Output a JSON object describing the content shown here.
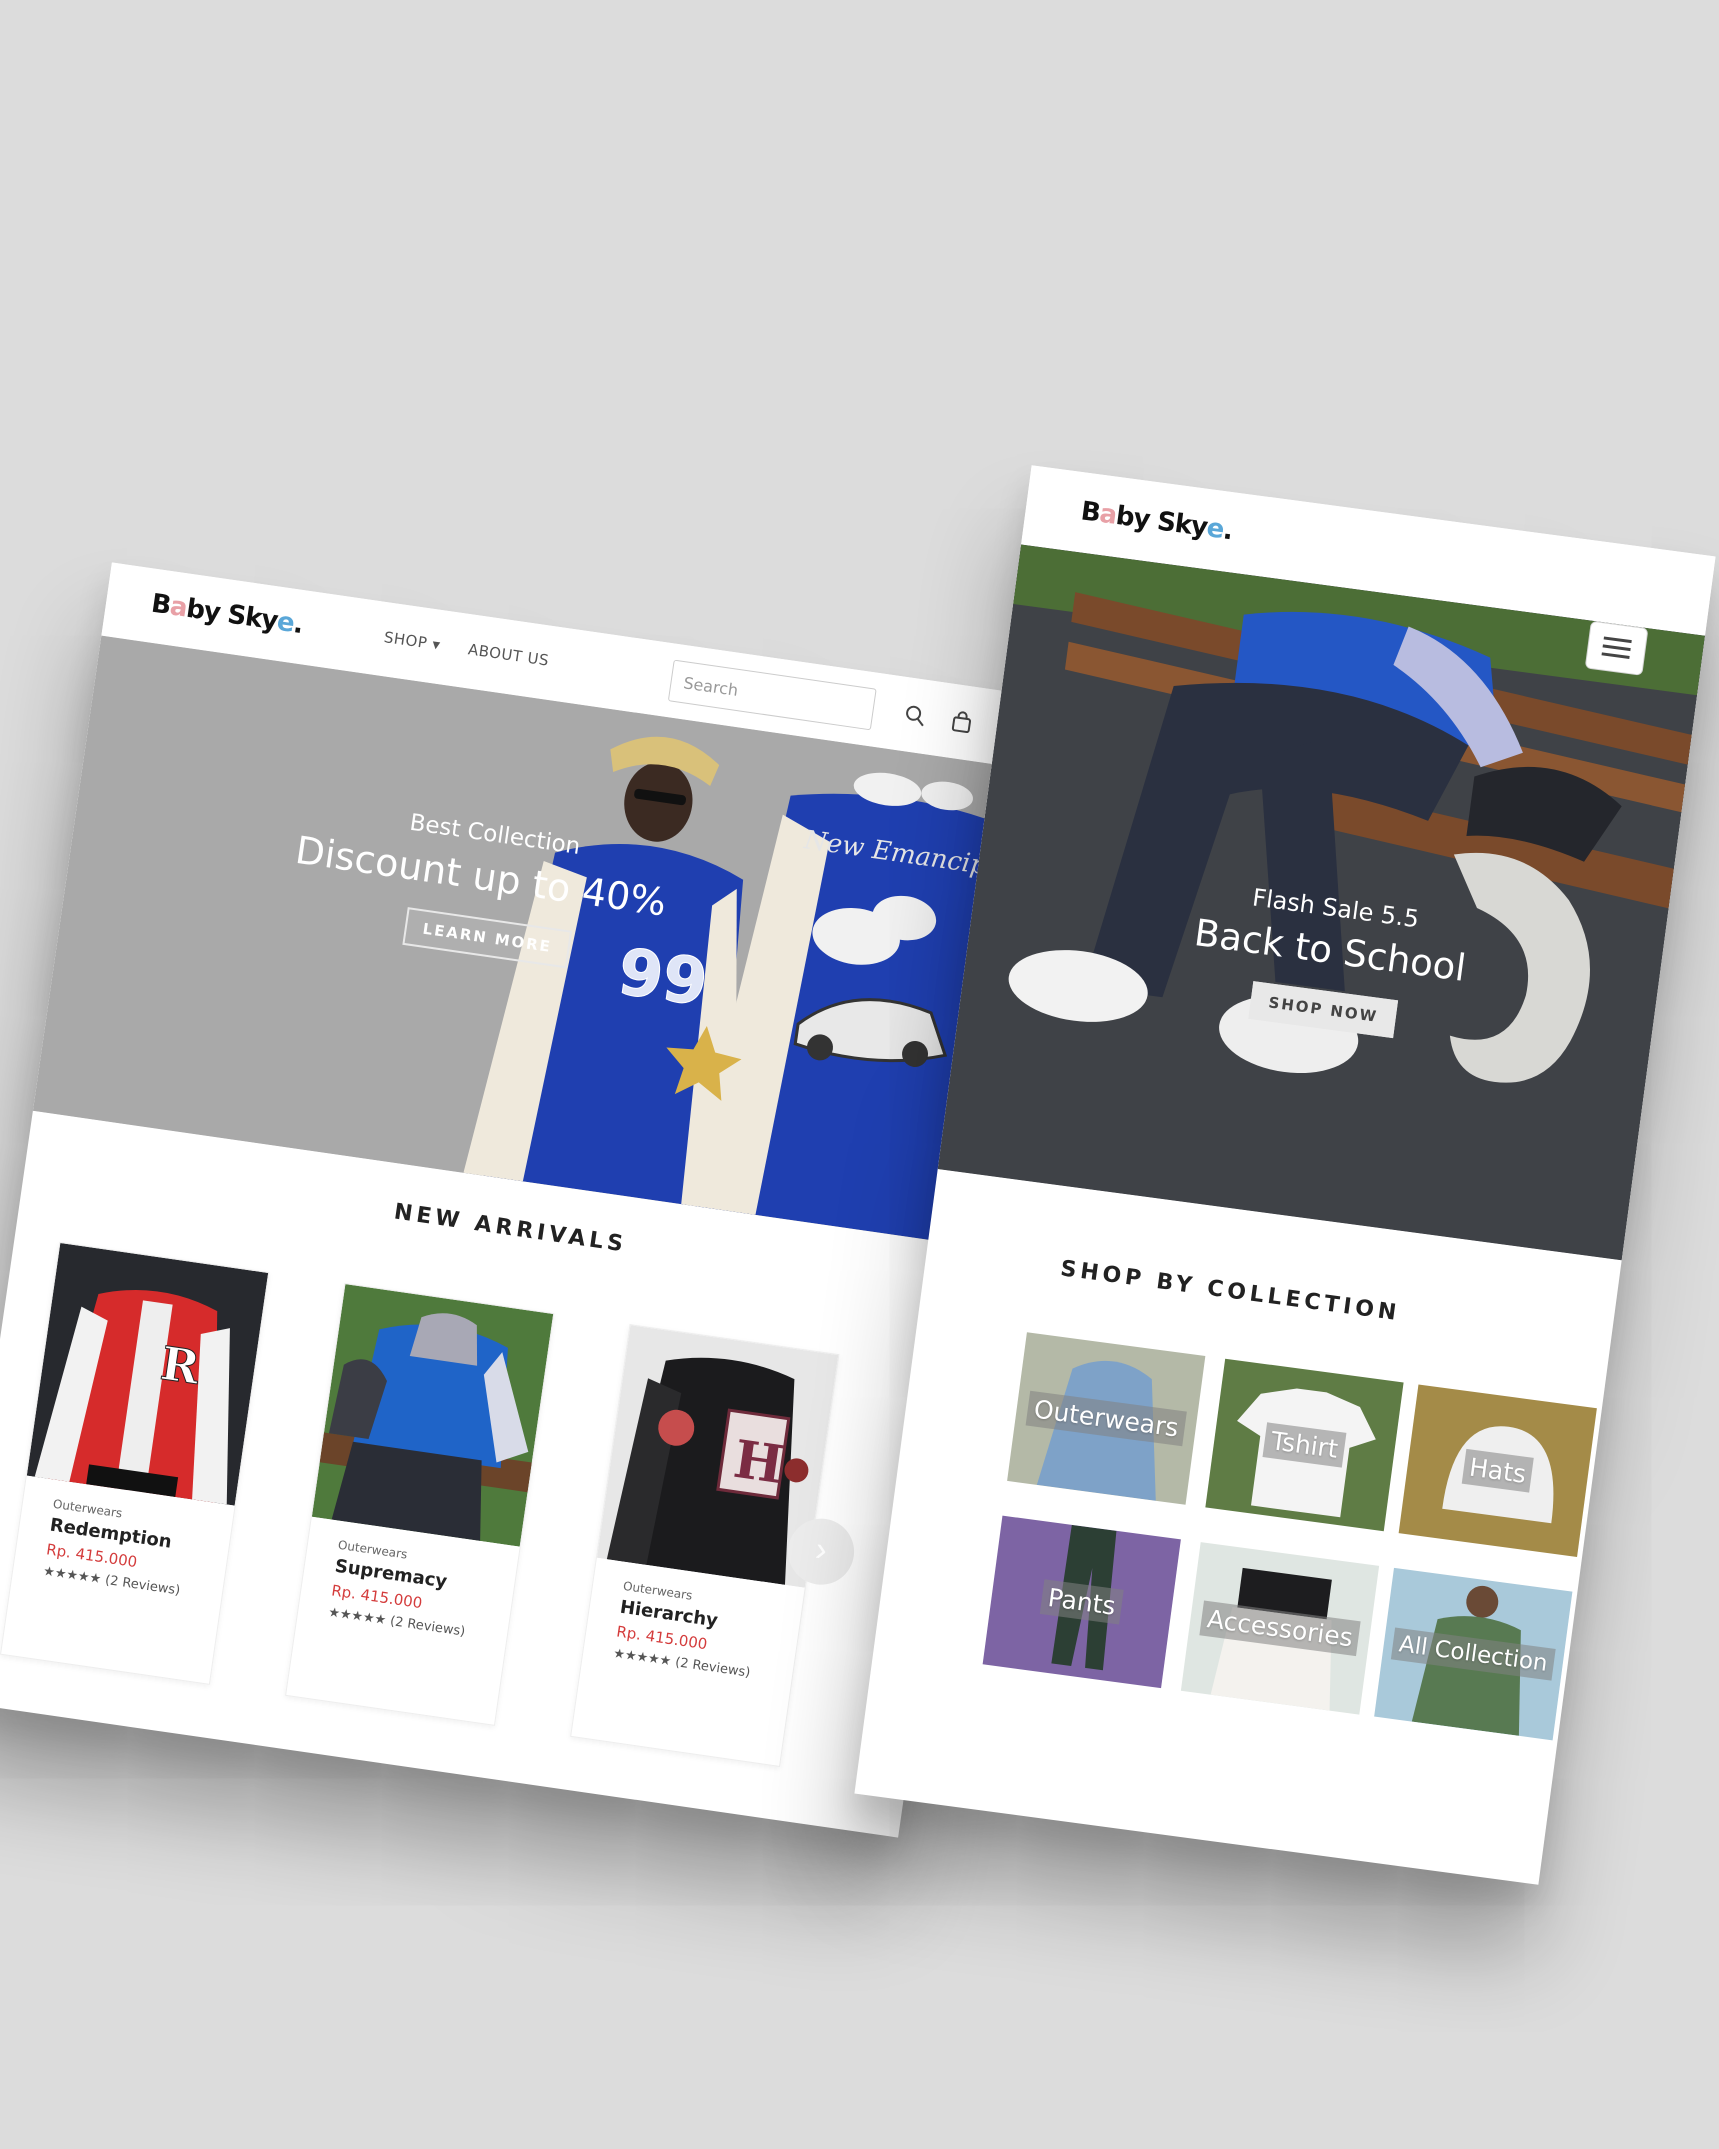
{
  "brand": {
    "logo_part1": "B",
    "logo_a": "a",
    "logo_part2": "by Sky",
    "logo_e": "e",
    "logo_dot": "."
  },
  "colors": {
    "background": "#dcdcdc",
    "price": "#d43c3c",
    "logo_a": "#e8a0a6",
    "logo_e": "#5aa7d8",
    "jacket_blue": "#1f3fb0"
  },
  "desktop": {
    "nav": {
      "shop_label": "SHOP",
      "shop_caret": "▾",
      "about_label": "ABOUT US"
    },
    "search": {
      "placeholder": "Search"
    },
    "icons": [
      "search-icon",
      "bag-icon",
      "user-icon"
    ],
    "hero": {
      "subtitle": "Best Collection",
      "title": "Discount up to 40%",
      "button": "LEARN MORE"
    },
    "new_arrivals": {
      "title": "NEW ARRIVALS",
      "products": [
        {
          "category": "Outerwears",
          "name": "Redemption",
          "price": "Rp. 415.000",
          "stars": "★★★★★",
          "reviews": "(2 Reviews)"
        },
        {
          "category": "Outerwears",
          "name": "Supremacy",
          "price": "Rp. 415.000",
          "stars": "★★★★★",
          "reviews": "(2 Reviews)"
        },
        {
          "category": "Outerwears",
          "name": "Hierarchy",
          "price": "Rp. 415.000",
          "stars": "★★★★★",
          "reviews": "(2 Reviews)"
        }
      ],
      "next_icon": "›"
    }
  },
  "mobile": {
    "hero": {
      "subtitle": "Flash Sale 5.5",
      "title": "Back to School",
      "button": "SHOP NOW"
    },
    "collection": {
      "title": "SHOP BY COLLECTION",
      "tiles": [
        {
          "label": "Outerwears",
          "color": "#b4b9a7"
        },
        {
          "label": "Tshirt",
          "color": "#5f7c45"
        },
        {
          "label": "Hats",
          "color": "#a48b48"
        },
        {
          "label": "Pants",
          "color": "#7d64a4"
        },
        {
          "label": "Accessories",
          "color": "#dfe6e2"
        },
        {
          "label": "All Collection",
          "color": "#a9c9da"
        }
      ]
    }
  }
}
